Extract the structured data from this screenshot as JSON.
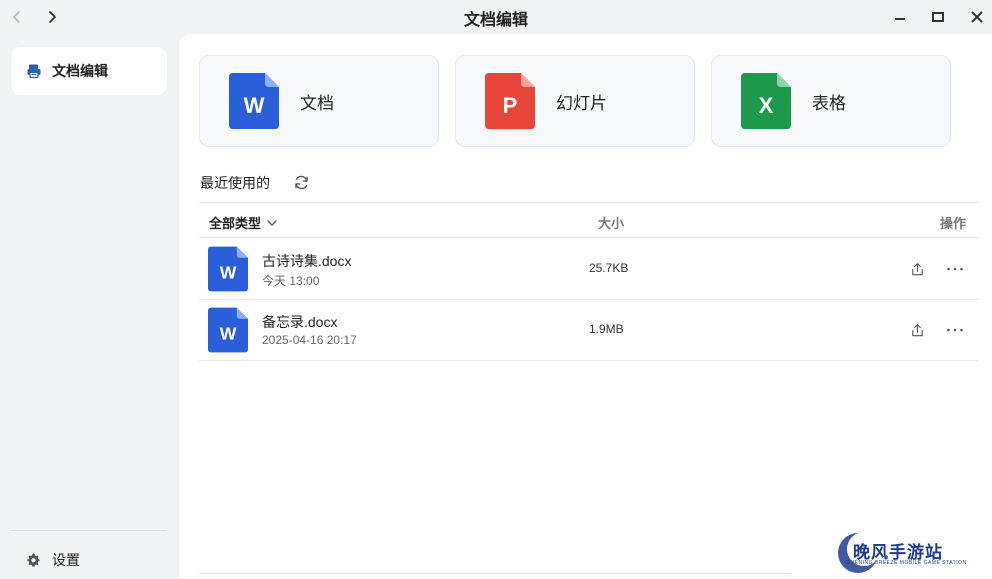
{
  "window": {
    "title": "文档编辑"
  },
  "sidebar": {
    "items": [
      {
        "label": "文档编辑",
        "icon": "printer-doc-icon"
      }
    ],
    "settings_label": "设置"
  },
  "quick_create": [
    {
      "letter": "W",
      "label": "文档",
      "color": "#2b5fd9"
    },
    {
      "letter": "P",
      "label": "幻灯片",
      "color": "#e8463a"
    },
    {
      "letter": "X",
      "label": "表格",
      "color": "#1f9a4c"
    }
  ],
  "recent": {
    "title": "最近使用的",
    "columns": {
      "type": "全部类型",
      "size": "大小",
      "action": "操作"
    },
    "files": [
      {
        "icon_letter": "W",
        "name": "古诗诗集.docx",
        "date": "今天 13:00",
        "size": "25.7KB"
      },
      {
        "icon_letter": "W",
        "name": "备忘录.docx",
        "date": "2025-04-16 20:17",
        "size": "1.9MB"
      }
    ]
  },
  "watermark": {
    "text": "晚风手游站",
    "sub": "EVENING BREEZE MOBILE GAME STATION"
  }
}
